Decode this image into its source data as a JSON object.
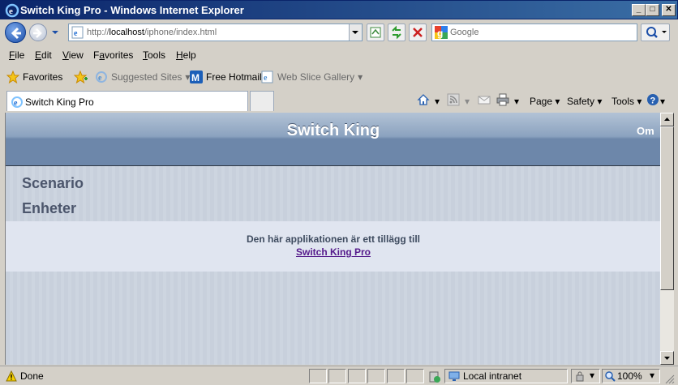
{
  "window": {
    "title": "Switch King Pro - Windows Internet Explorer",
    "buttons": {
      "minimize": "_",
      "maximize": "□",
      "close": "✕"
    }
  },
  "address_bar": {
    "url_prefix": "http://",
    "url_host": "localhost",
    "url_path": "/iphone/index.html"
  },
  "search": {
    "placeholder": "Google"
  },
  "menu": {
    "items": [
      "File",
      "Edit",
      "View",
      "Favorites",
      "Tools",
      "Help"
    ],
    "mnemonics": [
      "F",
      "E",
      "V",
      "a",
      "T",
      "H"
    ]
  },
  "favorites_bar": {
    "favorites_label": "Favorites",
    "suggested_sites": "Suggested Sites",
    "free_hotmail": "Free Hotmail",
    "web_slice_gallery": "Web Slice Gallery"
  },
  "tab": {
    "label": "Switch King Pro"
  },
  "command_bar": {
    "page": "Page",
    "safety": "Safety",
    "tools": "Tools"
  },
  "app": {
    "title": "Switch King",
    "about_link": "Om",
    "sections": [
      "Scenario",
      "Enheter"
    ],
    "info_text": "Den här applikationen är ett tillägg till",
    "info_link": "Switch King Pro"
  },
  "status_bar": {
    "status": "Done",
    "zone": "Local intranet",
    "zoom": "100%"
  },
  "colors": {
    "header_top": "#b3c3d6",
    "header_bottom": "#6d87aa",
    "section_text": "#4c566c",
    "link_visited": "#551a8b"
  }
}
